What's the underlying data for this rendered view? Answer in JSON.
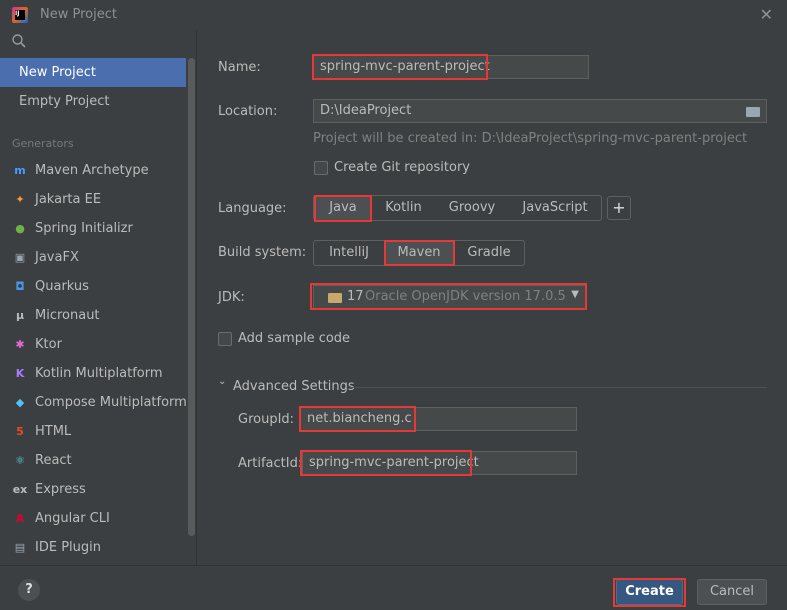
{
  "window": {
    "title": "New Project"
  },
  "sidebar": {
    "top_items": [
      "New Project",
      "Empty Project"
    ],
    "section_label": "Generators",
    "generators": [
      {
        "label": "Maven Archetype",
        "icon": "maven-icon",
        "glyph": "m",
        "color": "#4c9aff"
      },
      {
        "label": "Jakarta EE",
        "icon": "jakarta-icon",
        "glyph": "✦",
        "color": "#f0a030"
      },
      {
        "label": "Spring Initializr",
        "icon": "spring-icon",
        "glyph": "●",
        "color": "#6db33f"
      },
      {
        "label": "JavaFX",
        "icon": "javafx-icon",
        "glyph": "▣",
        "color": "#9aa7b0"
      },
      {
        "label": "Quarkus",
        "icon": "quarkus-icon",
        "glyph": "◘",
        "color": "#4695eb"
      },
      {
        "label": "Micronaut",
        "icon": "micronaut-icon",
        "glyph": "μ",
        "color": "#bbbbbb"
      },
      {
        "label": "Ktor",
        "icon": "ktor-icon",
        "glyph": "✱",
        "color": "#e56ad0"
      },
      {
        "label": "Kotlin Multiplatform",
        "icon": "kotlin-icon",
        "glyph": "K",
        "color": "#a97bff"
      },
      {
        "label": "Compose Multiplatform",
        "icon": "compose-icon",
        "glyph": "◆",
        "color": "#4fc3f7"
      },
      {
        "label": "HTML",
        "icon": "html5-icon",
        "glyph": "5",
        "color": "#e44d26"
      },
      {
        "label": "React",
        "icon": "react-icon",
        "glyph": "⚛",
        "color": "#61dafb"
      },
      {
        "label": "Express",
        "icon": "express-icon",
        "glyph": "ex",
        "color": "#bbbbbb"
      },
      {
        "label": "Angular CLI",
        "icon": "angular-icon",
        "glyph": "A",
        "color": "#dd0031"
      },
      {
        "label": "IDE Plugin",
        "icon": "plugin-icon",
        "glyph": "▤",
        "color": "#9aa7b0"
      }
    ]
  },
  "form": {
    "name_label": "Name:",
    "name_value": "spring-mvc-parent-project",
    "location_label": "Location:",
    "location_value": "D:\\IdeaProject",
    "location_hint": "Project will be created in: D:\\IdeaProject\\spring-mvc-parent-project",
    "git_label": "Create Git repository",
    "language_label": "Language:",
    "languages": [
      "Java",
      "Kotlin",
      "Groovy",
      "JavaScript"
    ],
    "language_selected": "Java",
    "build_label": "Build system:",
    "build_systems": [
      "IntelliJ",
      "Maven",
      "Gradle"
    ],
    "build_selected": "Maven",
    "jdk_label": "JDK:",
    "jdk_version": "17",
    "jdk_name": "Oracle OpenJDK version 17.0.5",
    "sample_label": "Add sample code",
    "advanced_label": "Advanced Settings",
    "groupid_label": "GroupId:",
    "groupid_value": "net.biancheng.c",
    "artifactid_label": "ArtifactId:",
    "artifactid_value": "spring-mvc-parent-project"
  },
  "footer": {
    "help": "?",
    "create": "Create",
    "cancel": "Cancel"
  }
}
